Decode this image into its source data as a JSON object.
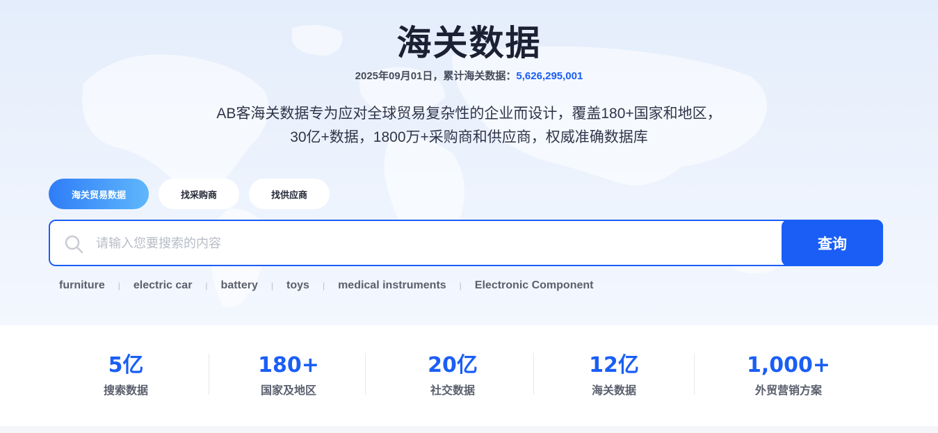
{
  "hero": {
    "title": "海关数据",
    "date_prefix": "2025年09月01日，累计海关数据：",
    "total_count": "5,626,295,001",
    "desc_line1": "AB客海关数据专为应对全球贸易复杂性的企业而设计，覆盖180+国家和地区，",
    "desc_line2": "30亿+数据，1800万+采购商和供应商，权威准确数据库"
  },
  "tabs": [
    {
      "label": "海关贸易数据",
      "active": true
    },
    {
      "label": "找采购商",
      "active": false
    },
    {
      "label": "找供应商",
      "active": false
    }
  ],
  "search": {
    "placeholder": "请输入您要搜索的内容",
    "value": "",
    "button_label": "查询"
  },
  "hot_keywords": [
    "furniture",
    "electric car",
    "battery",
    "toys",
    "medical instruments",
    "Electronic Component"
  ],
  "hot_separator": "|",
  "stats": [
    {
      "value": "5亿",
      "label": "搜索数据"
    },
    {
      "value": "180+",
      "label": "国家及地区"
    },
    {
      "value": "20亿",
      "label": "社交数据"
    },
    {
      "value": "12亿",
      "label": "海关数据"
    },
    {
      "value": "1,000+",
      "label": "外贸营销方案"
    }
  ],
  "icons": {
    "search": "search-icon",
    "background": "world-map-icon"
  },
  "colors": {
    "accent": "#1a5ef5",
    "tab_gradient_start": "#2f7df7",
    "tab_gradient_end": "#5fb7fb",
    "title": "#1c2033"
  }
}
